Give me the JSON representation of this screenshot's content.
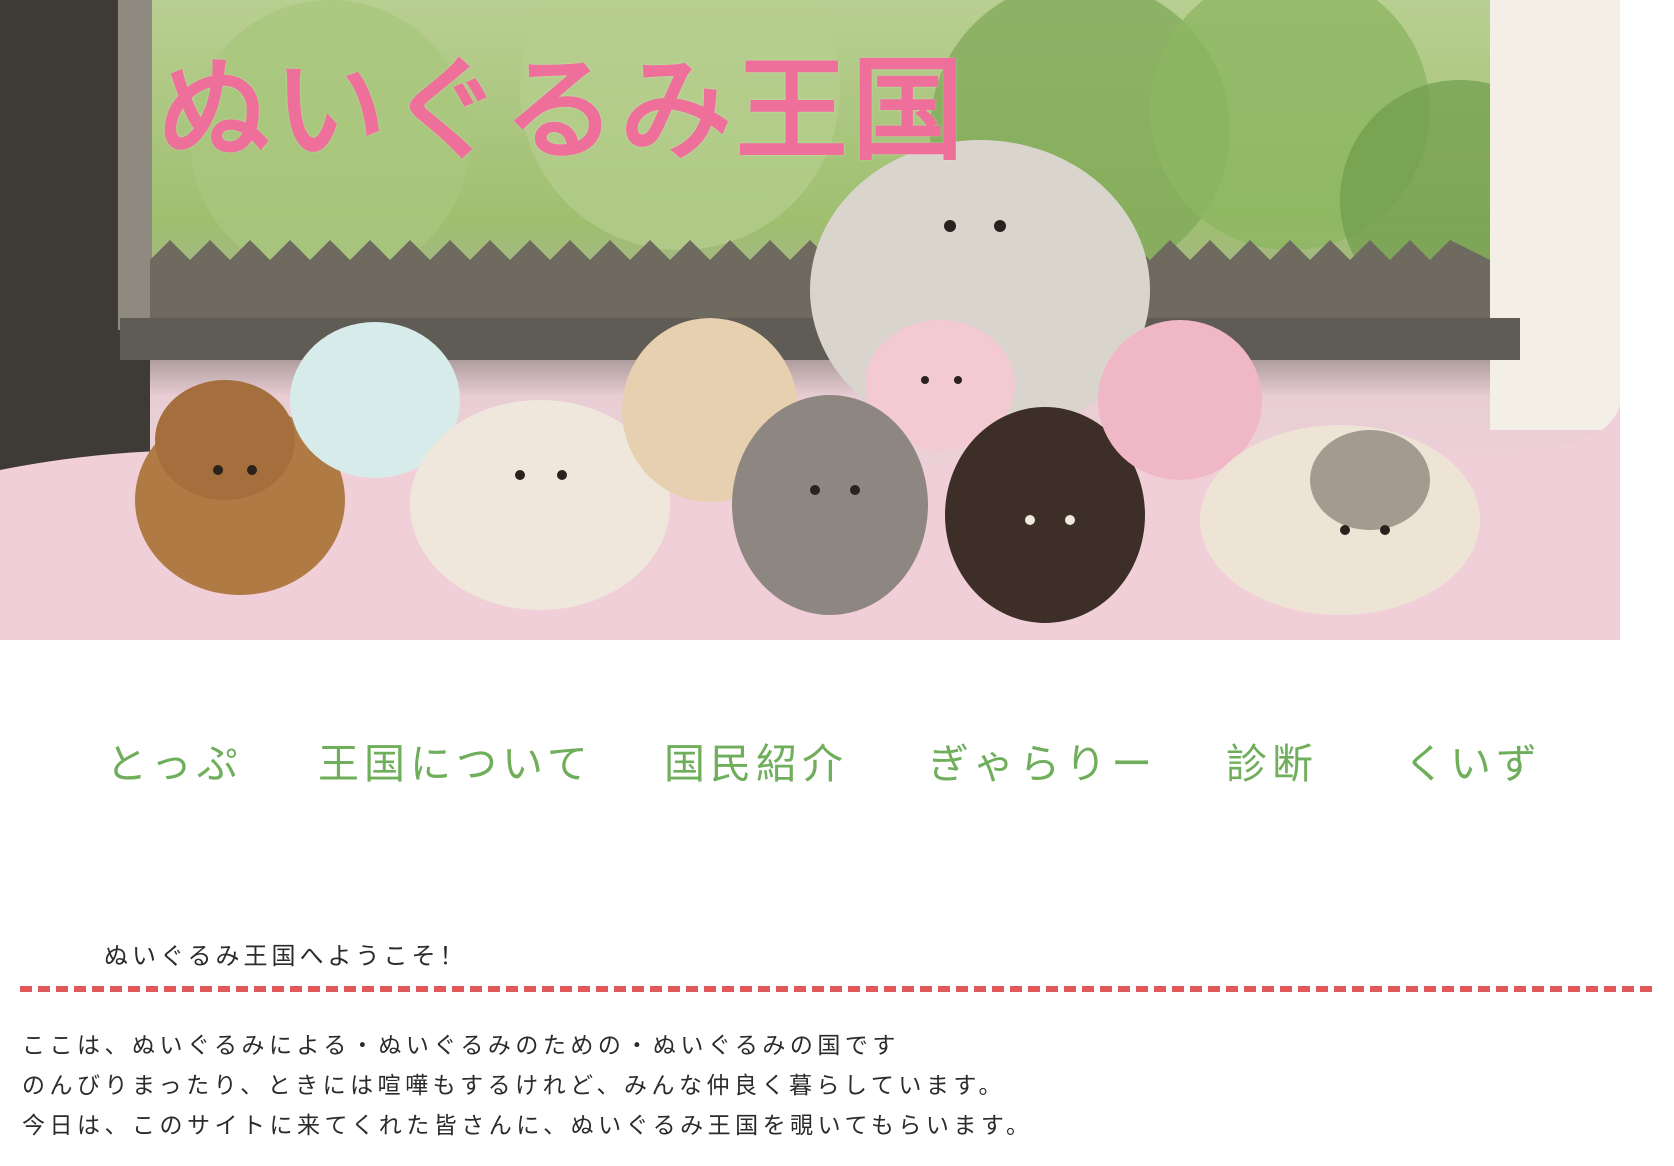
{
  "header": {
    "title": "ぬいぐるみ王国",
    "image_icon": "plush-toys-photo"
  },
  "nav": {
    "items": [
      {
        "label": "とっぷ"
      },
      {
        "label": "王国について"
      },
      {
        "label": "国民紹介"
      },
      {
        "label": "ぎゃらりー"
      },
      {
        "label": "診断"
      },
      {
        "label": "くいず"
      }
    ]
  },
  "main": {
    "welcome": "ぬいぐるみ王国へようこそ！",
    "paragraphs": [
      "ここは、ぬいぐるみによる・ぬいぐるみのための・ぬいぐるみの国です",
      "のんびりまったり、ときには喧嘩もするけれど、みんな仲良く暮らしています。",
      "今日は、このサイトに来てくれた皆さんに、ぬいぐるみ王国を覗いてもらいます。"
    ]
  },
  "colors": {
    "title": "#ef6f9b",
    "nav": "#6fae5a",
    "divider": "#e05858",
    "text": "#2b2b2b"
  }
}
